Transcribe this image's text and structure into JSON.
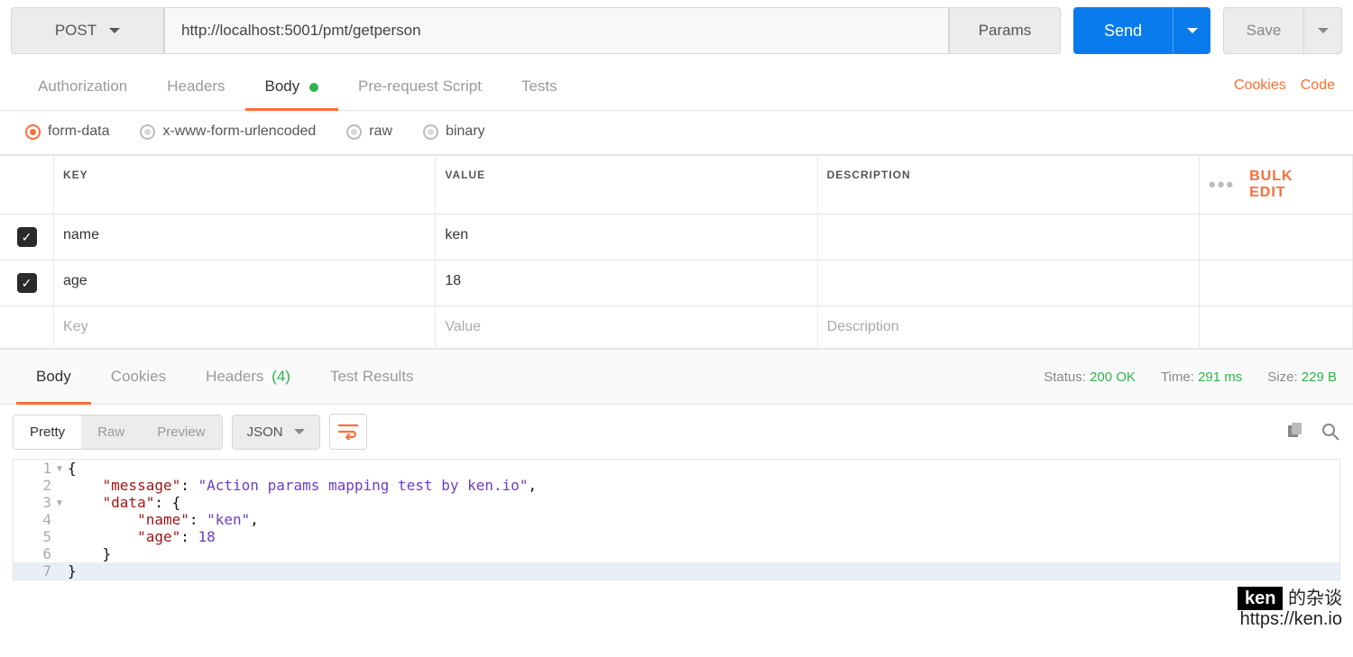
{
  "request": {
    "method": "POST",
    "url": "http://localhost:5001/pmt/getperson",
    "params_label": "Params",
    "send_label": "Send",
    "save_label": "Save"
  },
  "req_tabs": {
    "authorization": "Authorization",
    "headers": "Headers",
    "body": "Body",
    "prerequest": "Pre-request Script",
    "tests": "Tests",
    "cookies_link": "Cookies",
    "code_link": "Code"
  },
  "body_type": {
    "form_data": "form-data",
    "urlencoded": "x-www-form-urlencoded",
    "raw": "raw",
    "binary": "binary"
  },
  "kv": {
    "headers": {
      "key": "KEY",
      "value": "VALUE",
      "description": "DESCRIPTION"
    },
    "bulk_edit": "Bulk Edit",
    "rows": [
      {
        "enabled": true,
        "key": "name",
        "value": "ken",
        "description": ""
      },
      {
        "enabled": true,
        "key": "age",
        "value": "18",
        "description": ""
      }
    ],
    "placeholders": {
      "key": "Key",
      "value": "Value",
      "description": "Description"
    }
  },
  "resp_tabs": {
    "body": "Body",
    "cookies": "Cookies",
    "headers": "Headers",
    "headers_count": "(4)",
    "tests": "Test Results"
  },
  "resp_meta": {
    "status_label": "Status:",
    "status_value": "200 OK",
    "time_label": "Time:",
    "time_value": "291 ms",
    "size_label": "Size:",
    "size_value": "229 B"
  },
  "resp_toolbar": {
    "pretty": "Pretty",
    "raw": "Raw",
    "preview": "Preview",
    "format": "JSON"
  },
  "code": {
    "l1": "{",
    "l2_k": "\"message\"",
    "l2_v": "\"Action params mapping test by ken.io\"",
    "l3_k": "\"data\"",
    "l4_k": "\"name\"",
    "l4_v": "\"ken\"",
    "l5_k": "\"age\"",
    "l5_v": "18",
    "l6": "    }",
    "l7": "}"
  },
  "watermark": {
    "ken": "ken",
    "suffix": " 的杂谈",
    "url": "https://ken.io"
  }
}
